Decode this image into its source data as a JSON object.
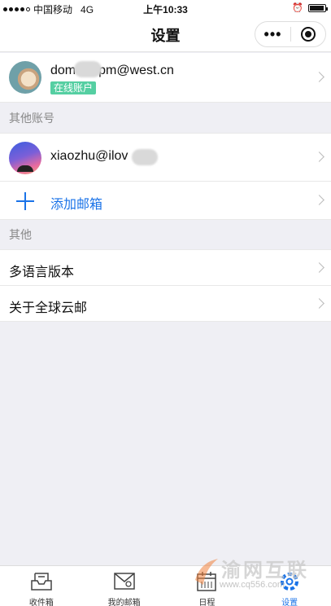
{
  "status_bar": {
    "carrier": "中国移动",
    "network": "4G",
    "time": "上午10:33"
  },
  "nav": {
    "title": "设置",
    "more_icon": "more-dots-icon",
    "close_icon": "miniprogram-close-icon"
  },
  "primary_account": {
    "email_prefix": "dom",
    "email_suffix": "pm@west.cn",
    "badge": "在线账户"
  },
  "other_accounts_header": "其他账号",
  "other_account": {
    "email": "xiaozhu@ilov"
  },
  "add_mailbox": "添加邮箱",
  "other_header": "其他",
  "menu": [
    {
      "label": "多语言版本"
    },
    {
      "label": "关于全球云邮"
    }
  ],
  "tabs": [
    {
      "label": "收件箱",
      "icon": "inbox-icon"
    },
    {
      "label": "我的邮箱",
      "icon": "mailbox-icon"
    },
    {
      "label": "日程",
      "icon": "calendar-icon"
    },
    {
      "label": "设置",
      "icon": "settings-icon"
    }
  ],
  "watermark": {
    "text": "渝网互联",
    "url": "www.cq556.com"
  },
  "colors": {
    "accent": "#1a73e8",
    "badge": "#55cfa2",
    "background": "#efeff4"
  }
}
